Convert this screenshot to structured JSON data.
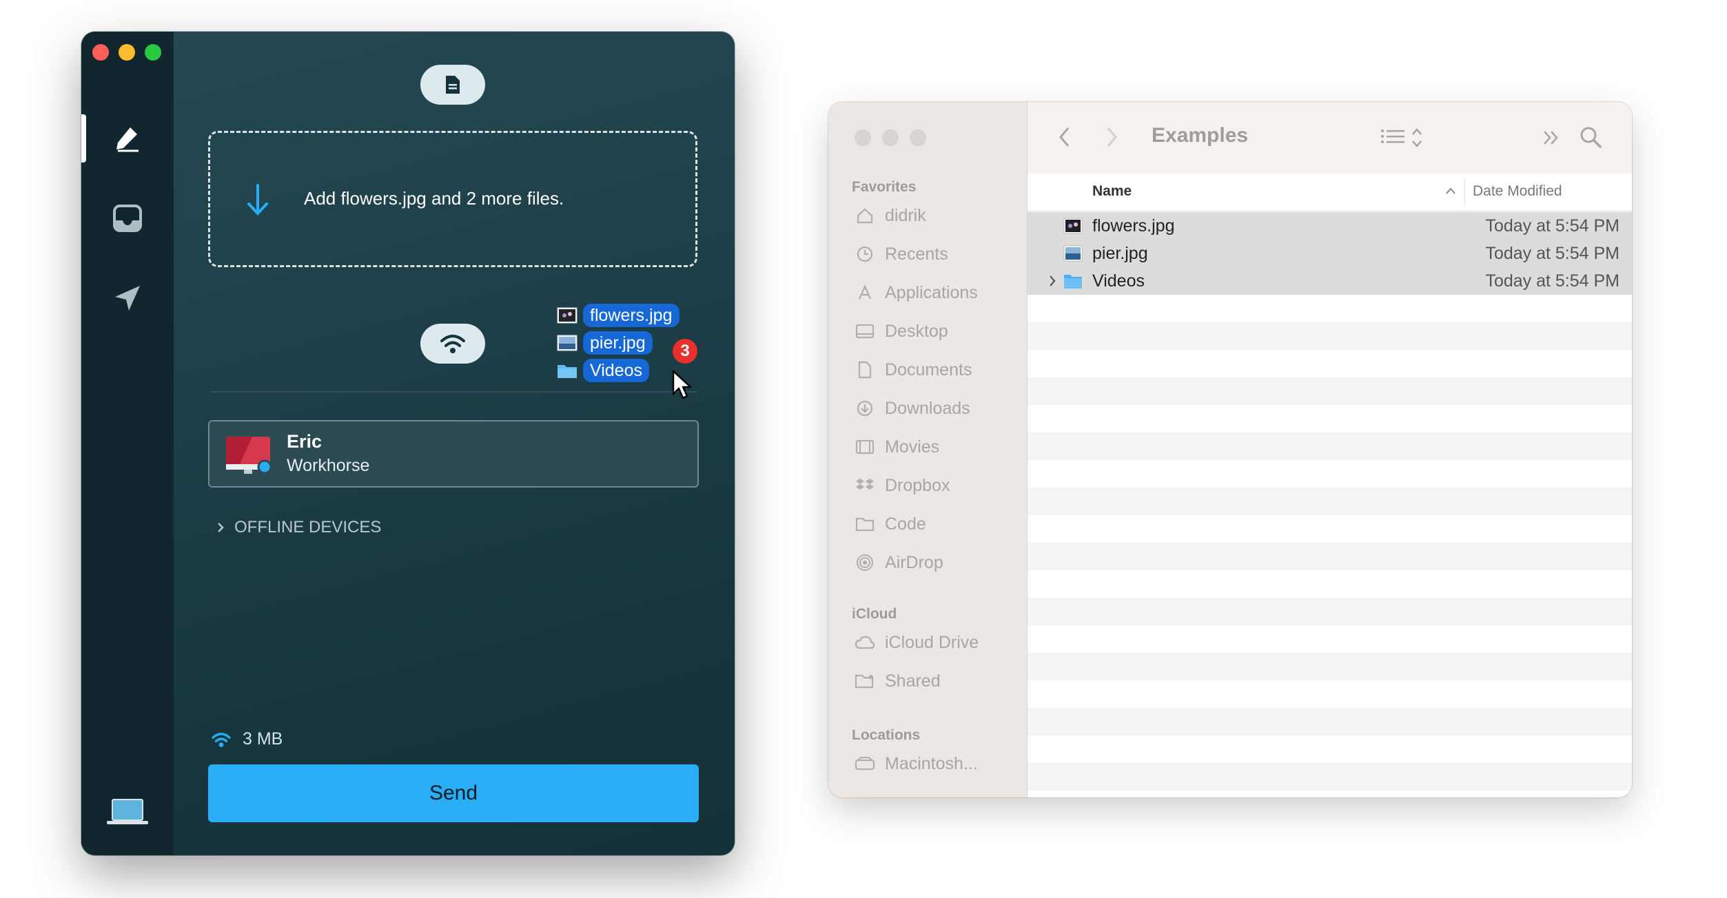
{
  "app": {
    "drop_text": "Add flowers.jpg and 2 more files.",
    "drag_items": [
      {
        "name": "flowers.jpg",
        "icon": "image-file-icon"
      },
      {
        "name": "pier.jpg",
        "icon": "image-file-icon"
      },
      {
        "name": "Videos",
        "icon": "folder-icon"
      }
    ],
    "drag_count": "3",
    "device": {
      "name": "Eric",
      "host": "Workhorse"
    },
    "offline_label": "OFFLINE DEVICES",
    "transfer_size": "3 MB",
    "send_label": "Send",
    "accent_color": "#29adf5"
  },
  "finder": {
    "title": "Examples",
    "sidebar": {
      "favorites_label": "Favorites",
      "favorites": [
        {
          "label": "didrik",
          "icon": "home-icon"
        },
        {
          "label": "Recents",
          "icon": "clock-icon"
        },
        {
          "label": "Applications",
          "icon": "applications-icon"
        },
        {
          "label": "Desktop",
          "icon": "desktop-icon"
        },
        {
          "label": "Documents",
          "icon": "document-icon"
        },
        {
          "label": "Downloads",
          "icon": "download-icon"
        },
        {
          "label": "Movies",
          "icon": "film-icon"
        },
        {
          "label": "Dropbox",
          "icon": "dropbox-icon"
        },
        {
          "label": "Code",
          "icon": "folder-icon"
        },
        {
          "label": "AirDrop",
          "icon": "airdrop-icon"
        }
      ],
      "icloud_label": "iCloud",
      "icloud": [
        {
          "label": "iCloud Drive",
          "icon": "cloud-icon"
        },
        {
          "label": "Shared",
          "icon": "shared-folder-icon"
        }
      ],
      "locations_label": "Locations",
      "locations": [
        {
          "label": "Macintosh...",
          "icon": "disk-icon"
        }
      ]
    },
    "columns": {
      "name": "Name",
      "date": "Date Modified"
    },
    "rows": [
      {
        "name": "flowers.jpg",
        "date": "Today at 5:54 PM",
        "type": "image"
      },
      {
        "name": "pier.jpg",
        "date": "Today at 5:54 PM",
        "type": "image"
      },
      {
        "name": "Videos",
        "date": "Today at 5:54 PM",
        "type": "folder"
      }
    ]
  }
}
